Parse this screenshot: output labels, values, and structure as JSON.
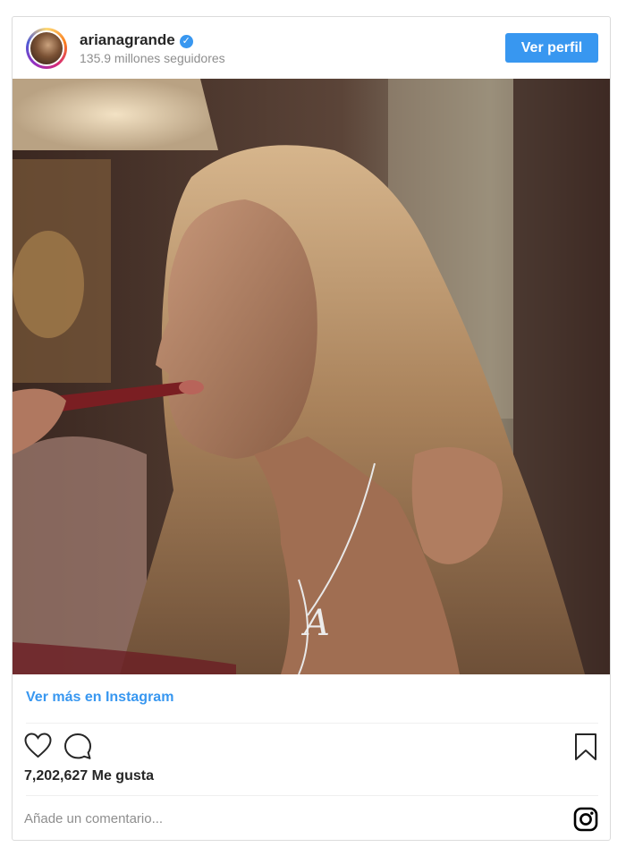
{
  "post": {
    "username": "arianagrande",
    "followers": "135.9 millones seguidores",
    "profile_button": "Ver perfil",
    "view_more": "Ver más en Instagram",
    "likes": "7,202,627 Me gusta",
    "comment_placeholder": "Añade un comentario..."
  },
  "icons": {
    "verified": "verified-badge-icon",
    "like": "heart-icon",
    "comment": "comment-icon",
    "save": "bookmark-icon",
    "brand": "instagram-logo-icon"
  },
  "colors": {
    "accent": "#3897f0",
    "text": "#262626",
    "muted": "#8e8e8e",
    "border": "#dbdbdb"
  }
}
